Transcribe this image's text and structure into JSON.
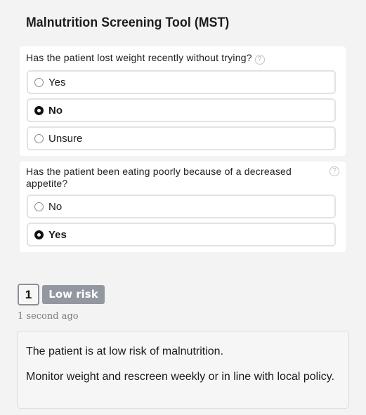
{
  "title": "Malnutrition Screening Tool (MST)",
  "questions": [
    {
      "text": "Has the patient lost weight recently without trying?",
      "help_icon": "?",
      "options": [
        {
          "label": "Yes",
          "selected": false
        },
        {
          "label": "No",
          "selected": true
        },
        {
          "label": "Unsure",
          "selected": false
        }
      ]
    },
    {
      "text": "Has the patient been eating poorly because of a decreased appetite?",
      "help_icon": "?",
      "options": [
        {
          "label": "No",
          "selected": false
        },
        {
          "label": "Yes",
          "selected": true
        }
      ]
    }
  ],
  "result": {
    "score": "1",
    "risk_label": "Low risk",
    "timestamp": "1 second ago",
    "message_1": "The patient is at low risk of malnutrition.",
    "message_2": "Monitor weight and rescreen weekly or in line with local policy."
  },
  "colors": {
    "background": "#f3f3f3",
    "badge": "#9297a0",
    "selected_radio": "#111111"
  }
}
